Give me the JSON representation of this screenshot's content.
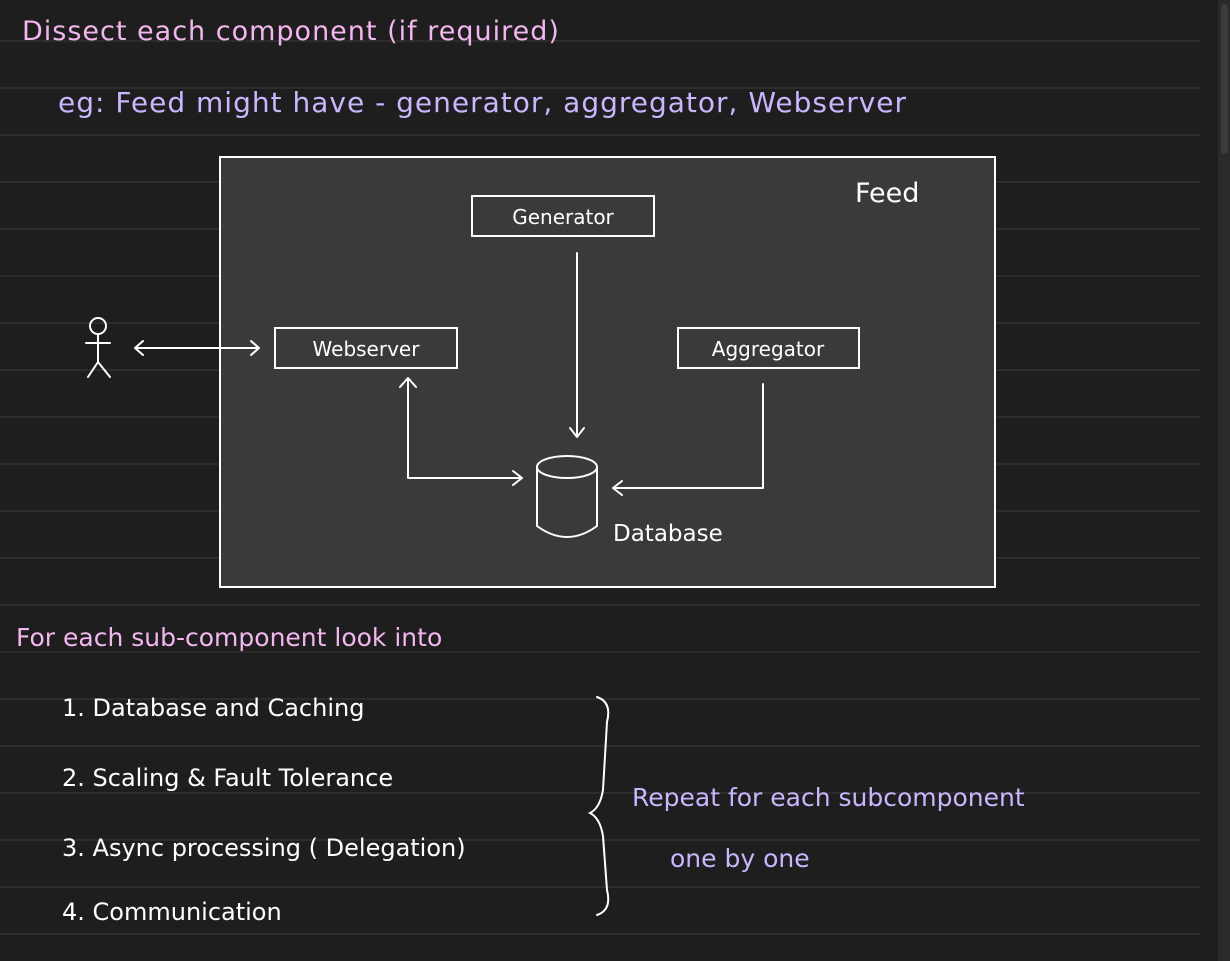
{
  "note": {
    "heading": "Dissect each component (if required)",
    "example": "eg: Feed might have  -  generator, aggregator, Webserver"
  },
  "diagram": {
    "container_label": "Feed",
    "generator_label": "Generator",
    "webserver_label": "Webserver",
    "aggregator_label": "Aggregator",
    "database_label": "Database"
  },
  "checklist": {
    "heading": "For each sub-component look into",
    "items": [
      "1.  Database and Caching",
      "2.  Scaling & Fault Tolerance",
      "3.  Async processing ( Delegation)",
      "4.  Communication"
    ],
    "repeat_line1": "Repeat for each subcomponent",
    "repeat_line2": "one by one"
  },
  "colors": {
    "background": "#1e1e1e",
    "ruled_line": "#3a3a3a",
    "heading_pink": "#f3b6ef",
    "example_purple": "#c9b6ff",
    "box_fill": "#3a3a3a",
    "ink_white": "#ffffff"
  }
}
